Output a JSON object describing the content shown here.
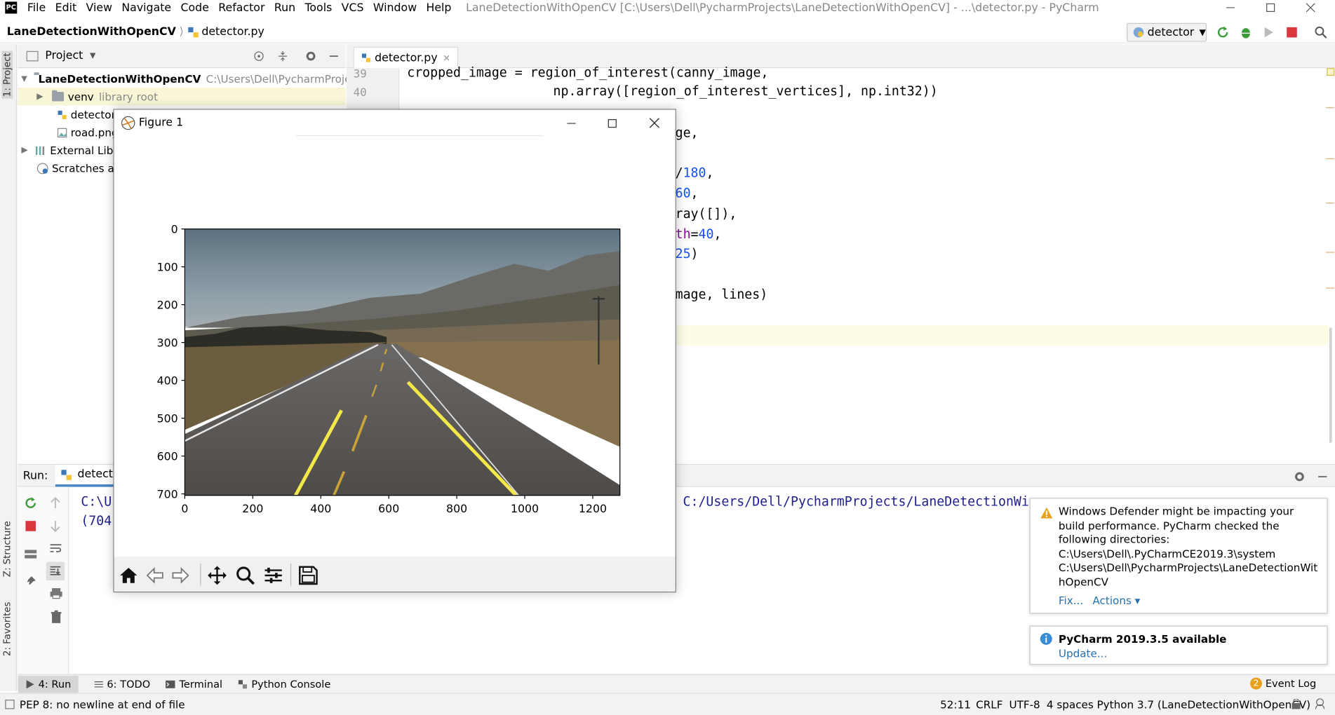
{
  "app": {
    "logo_text": "PC",
    "menu": [
      "File",
      "Edit",
      "View",
      "Navigate",
      "Code",
      "Refactor",
      "Run",
      "Tools",
      "VCS",
      "Window",
      "Help"
    ],
    "window_title": "LaneDetectionWithOpenCV [C:\\Users\\Dell\\PycharmProjects\\LaneDetectionWithOpenCV] - ...\\detector.py - PyCharm"
  },
  "navbar": {
    "project": "LaneDetectionWithOpenCV",
    "file": "detector.py",
    "run_config": "detector"
  },
  "project_panel": {
    "title": "Project",
    "tree": [
      {
        "label": "LaneDetectionWithOpenCV",
        "hint": "C:\\Users\\Dell\\PycharmProjects\\La"
      },
      {
        "label": "venv",
        "hint": "library root"
      },
      {
        "label": "detector.",
        "hint": ""
      },
      {
        "label": "road.png",
        "hint": ""
      },
      {
        "label": "External Libra",
        "hint": ""
      },
      {
        "label": "Scratches and",
        "hint": ""
      }
    ]
  },
  "left_tabs": {
    "project": "1: Project",
    "structure": "Z: Structure",
    "favorites": "2: Favorites"
  },
  "editor": {
    "tab": "detector.py",
    "line_numbers": [
      "39",
      "40"
    ],
    "code": {
      "l39": "cropped_image = region_of_interest(canny_image,",
      "l40": "                   np.array([region_of_interest_vertices], np.int32))",
      "l_a": "ge,",
      "l_b1": "/",
      "l_b2": "180",
      "l_b3": ",",
      "l_c1": "60",
      "l_c2": ",",
      "l_d": "ray([]),",
      "l_e1": "th",
      "l_e2": "=",
      "l_e3": "40",
      "l_e4": ",",
      "l_f1": "25",
      "l_f2": ")",
      "l_g": "mage, lines)"
    }
  },
  "run_panel": {
    "label": "Run:",
    "tab": "detecto",
    "console": {
      "line1_left": "C:\\U",
      "line1_right": "C:/Users/Dell/PycharmProjects/LaneDetectionWi",
      "line2": "(704"
    }
  },
  "figure": {
    "title": "Figure 1",
    "toolbar_icons": [
      "home-icon",
      "back-icon",
      "forward-icon",
      "pan-icon",
      "zoom-icon",
      "configure-icon",
      "save-icon"
    ]
  },
  "chart_data": {
    "type": "image",
    "x_ticks": [
      "0",
      "200",
      "400",
      "600",
      "800",
      "1000",
      "1200"
    ],
    "y_ticks": [
      "0",
      "100",
      "200",
      "300",
      "400",
      "500",
      "600",
      "700"
    ],
    "xlim": [
      0,
      1280
    ],
    "ylim": [
      704,
      0
    ]
  },
  "notifications": [
    {
      "type": "warning",
      "text": [
        "Windows Defender might be impacting your",
        "build performance. PyCharm checked the",
        "following directories:",
        "C:\\Users\\Dell\\.PyCharmCE2019.3\\system",
        "C:\\Users\\Dell\\PycharmProjects\\LaneDetectionWit",
        "hOpenCV"
      ],
      "actions": [
        "Fix...",
        "Actions ▾"
      ]
    },
    {
      "type": "info",
      "title": "PyCharm 2019.3.5 available",
      "action": "Update..."
    }
  ],
  "bottom_tabs": [
    {
      "num": "4",
      "label": "4: Run"
    },
    {
      "num": "6",
      "label": "6: TODO"
    },
    {
      "num": "",
      "label": "Terminal"
    },
    {
      "num": "",
      "label": "Python Console"
    }
  ],
  "event_log": {
    "count": "2",
    "label": "Event Log"
  },
  "status": {
    "message": "PEP 8: no newline at end of file",
    "position": "52:11",
    "line_sep": "CRLF",
    "encoding": "UTF-8",
    "indent": "4 spaces",
    "interpreter": "Python 3.7 (LaneDetectionWithOpenCV)"
  },
  "colors": {
    "accent": "#2470b3",
    "lane_yellow": "#f3e84a",
    "run_green": "#3c9a3c",
    "stop_red": "#d9363e"
  }
}
